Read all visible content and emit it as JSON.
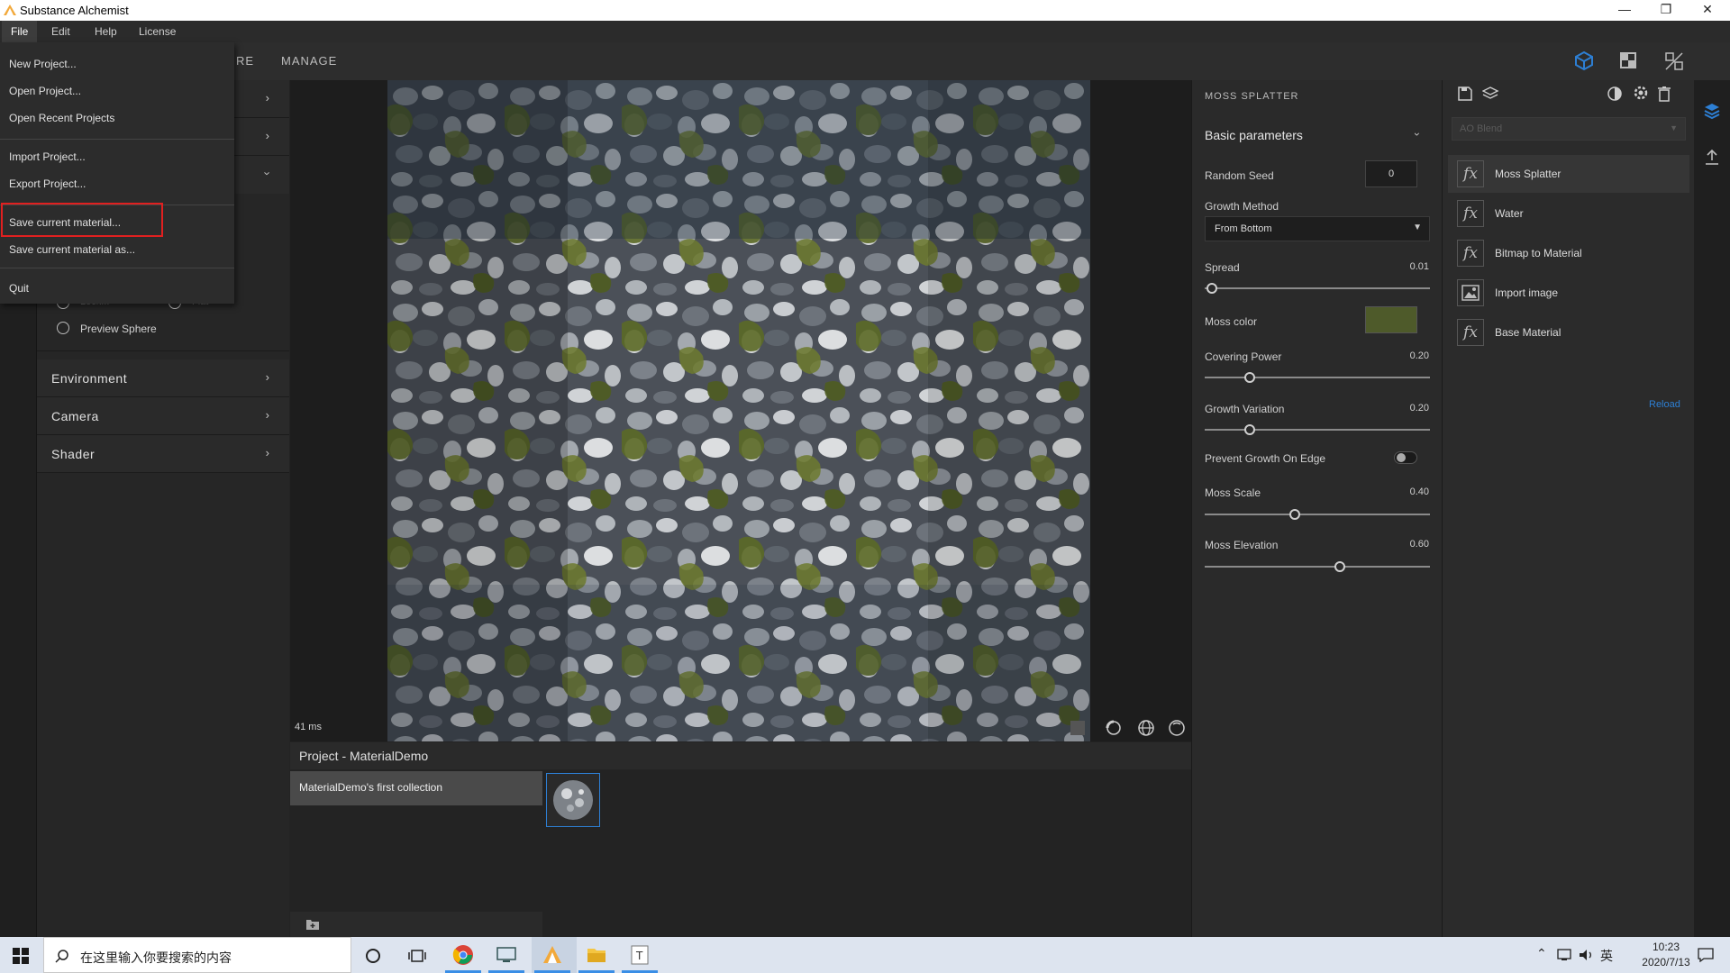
{
  "window": {
    "title": "Substance Alchemist"
  },
  "menubar": {
    "items": [
      "File",
      "Edit",
      "Help",
      "License"
    ]
  },
  "top_tabs": {
    "partial": "RE",
    "manage": "MANAGE"
  },
  "file_menu": {
    "items": [
      "New Project...",
      "Open Project...",
      "Open Recent Projects",
      "Import Project...",
      "Export Project...",
      "Save current material...",
      "Save current material as...",
      "Quit"
    ]
  },
  "left_panel": {
    "partial_left": "Lock...",
    "partial_right": "Flat",
    "preview_sphere": "Preview Sphere",
    "sections": [
      "Environment",
      "Camera",
      "Shader"
    ]
  },
  "viewport": {
    "frame_time": "41 ms"
  },
  "project": {
    "title": "Project - MaterialDemo",
    "collection": "MaterialDemo's first collection"
  },
  "params": {
    "header": "MOSS SPLATTER",
    "group": "Basic parameters",
    "random_seed": {
      "label": "Random Seed",
      "value": "0"
    },
    "growth_method": {
      "label": "Growth Method",
      "value": "From Bottom"
    },
    "spread": {
      "label": "Spread",
      "value": "0.01",
      "fraction": 0.03
    },
    "moss_color": {
      "label": "Moss color",
      "color": "#4e5a2a"
    },
    "covering_power": {
      "label": "Covering Power",
      "value": "0.20",
      "fraction": 0.2
    },
    "growth_variation": {
      "label": "Growth Variation",
      "value": "0.20",
      "fraction": 0.2
    },
    "prevent_growth": {
      "label": "Prevent Growth On Edge"
    },
    "moss_scale": {
      "label": "Moss Scale",
      "value": "0.40",
      "fraction": 0.4
    },
    "moss_elevation": {
      "label": "Moss Elevation",
      "value": "0.60",
      "fraction": 0.6
    }
  },
  "layers": {
    "blend_placeholder": "AO Blend",
    "items": [
      "Moss Splatter",
      "Water",
      "Bitmap to Material",
      "Import image",
      "Base Material"
    ],
    "reload": "Reload"
  },
  "taskbar": {
    "search_placeholder": "在这里输入你要搜索的内容",
    "clock_time": "10:23",
    "clock_date": "2020/7/13",
    "ime": "英"
  },
  "colors": {
    "accent": "#2d7fd4",
    "highlight": "#e02020",
    "moss": "#4e5a2a"
  }
}
